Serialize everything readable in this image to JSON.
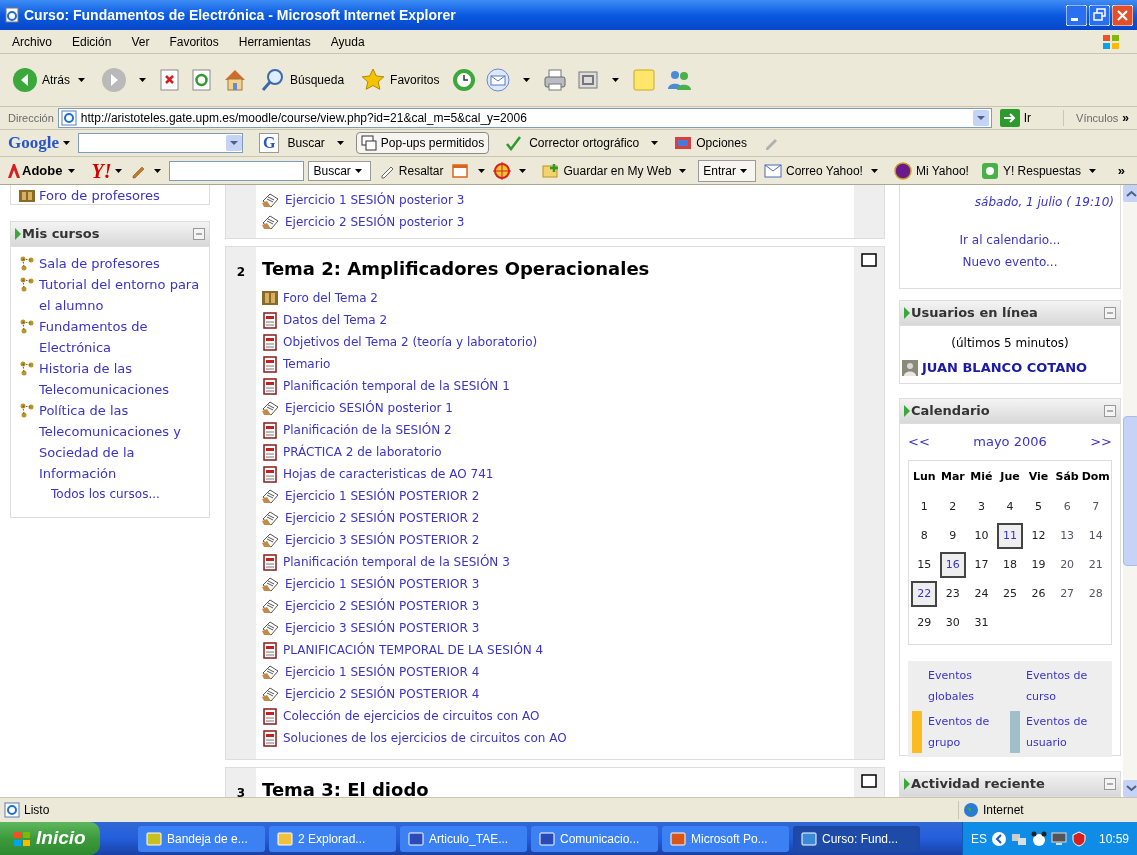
{
  "window": {
    "title": "Curso: Fundamentos de Electrónica - Microsoft Internet Explorer"
  },
  "menu": [
    "Archivo",
    "Edición",
    "Ver",
    "Favoritos",
    "Herramientas",
    "Ayuda"
  ],
  "toolbar": {
    "back": "Atrás",
    "search": "Búsqueda",
    "favorites": "Favoritos"
  },
  "address": {
    "label": "Dirección",
    "url": "http://aristoteles.gate.upm.es/moodle/course/view.php?id=21&cal_m=5&cal_y=2006",
    "go": "Ir",
    "links": "Vínculos",
    "more": "»"
  },
  "google_bar": {
    "logo": "Google",
    "search_letter": "G",
    "search": "Buscar",
    "popups": "Pop-ups permitidos",
    "spell": "Corrector ortográfico",
    "options": "Opciones"
  },
  "yahoo_bar": {
    "adobe": "Adobe",
    "yahoo": "Y!",
    "search": "Buscar",
    "highlight": "Resaltar",
    "save": "Guardar en My Web",
    "enter": "Entrar",
    "mail": "Correo Yahoo!",
    "my": "Mi Yahoo!",
    "answers": "Y! Respuestas",
    "more": "»"
  },
  "left": {
    "top_item": "Foro de profesores",
    "block": {
      "title": "Mis cursos",
      "items": [
        "Sala de profesores",
        "Tutorial del entorno para el alumno",
        "Fundamentos de Electrónica",
        "Historia de las Telecomunicaciones",
        "Política de las Telecomunicaciones y Sociedad de la Información"
      ],
      "all": "Todos los cursos..."
    }
  },
  "center": {
    "sections": [
      {
        "items": [
          {
            "label": "Ejercicio 1 SESIÓN posterior 3",
            "kind": "quiz"
          },
          {
            "label": "Ejercicio 2 SESIÓN posterior 3",
            "kind": "quiz"
          }
        ]
      },
      {
        "number": "2",
        "title": "Tema 2: Amplificadores Operacionales",
        "items": [
          {
            "label": "Foro del Tema 2",
            "kind": "forum"
          },
          {
            "label": "Datos del Tema 2",
            "kind": "pdf"
          },
          {
            "label": "Objetivos del Tema 2 (teoría y laboratorio)",
            "kind": "pdf"
          },
          {
            "label": "Temario",
            "kind": "pdf"
          },
          {
            "label": "Planificación temporal de la SESIÓN 1",
            "kind": "pdf"
          },
          {
            "label": "Ejercicio SESIÓN posterior 1",
            "kind": "quiz"
          },
          {
            "label": "Planificación de la SESIÓN 2",
            "kind": "pdf"
          },
          {
            "label": "PRÁCTICA 2 de laboratorio",
            "kind": "pdf"
          },
          {
            "label": "Hojas de caracteristicas de AO 741",
            "kind": "pdf"
          },
          {
            "label": "Ejercicio 1 SESIÓN POSTERIOR 2",
            "kind": "quiz"
          },
          {
            "label": "Ejercicio 2 SESIÓN POSTERIOR 2",
            "kind": "quiz"
          },
          {
            "label": "Ejercicio 3 SESIÓN POSTERIOR 2",
            "kind": "quiz"
          },
          {
            "label": "Planificación temporal de la SESIÓN 3",
            "kind": "pdf"
          },
          {
            "label": "Ejercicio 1 SESIÓN POSTERIOR 3",
            "kind": "quiz"
          },
          {
            "label": "Ejercicio 2 SESIÓN POSTERIOR 3",
            "kind": "quiz"
          },
          {
            "label": "Ejercicio 3 SESIÓN POSTERIOR 3",
            "kind": "quiz"
          },
          {
            "label": "PLANIFICACIÓN TEMPORAL DE LA SESIÓN 4",
            "kind": "pdf"
          },
          {
            "label": "Ejercicio 1 SESIÓN POSTERIOR 4",
            "kind": "quiz"
          },
          {
            "label": "Ejercicio 2 SESIÓN POSTERIOR 4",
            "kind": "quiz"
          },
          {
            "label": "Colección de ejercicios de circuitos con AO",
            "kind": "pdf"
          },
          {
            "label": "Soluciones de los ejercicios de circuitos con AO",
            "kind": "pdf"
          }
        ]
      },
      {
        "number": "3",
        "title": "Tema 3: El diodo"
      }
    ]
  },
  "right": {
    "events": {
      "date": "sábado, 1 julio ( 19:10)",
      "links": [
        "Ir al calendario...",
        "Nuevo evento..."
      ]
    },
    "online": {
      "title": "Usuarios en línea",
      "note": "(últimos 5 minutos)",
      "users": [
        "JUAN BLANCO COTANO"
      ]
    },
    "calendar": {
      "title": "Calendario",
      "prev": "<<",
      "month": "mayo 2006",
      "next": ">>",
      "weekdays": [
        "Lun",
        "Mar",
        "Mié",
        "Jue",
        "Vie",
        "Sáb",
        "Dom"
      ],
      "days": [
        {
          "label": "1",
          "highlighted": false
        },
        {
          "label": "2",
          "highlighted": false
        },
        {
          "label": "3",
          "highlighted": false
        },
        {
          "label": "4",
          "highlighted": false
        },
        {
          "label": "5",
          "highlighted": false
        },
        {
          "label": "6",
          "highlighted": false
        },
        {
          "label": "7",
          "highlighted": false
        },
        {
          "label": "8",
          "highlighted": false
        },
        {
          "label": "9",
          "highlighted": false
        },
        {
          "label": "10",
          "highlighted": false
        },
        {
          "label": "11",
          "highlighted": true
        },
        {
          "label": "12",
          "highlighted": false
        },
        {
          "label": "13",
          "highlighted": false
        },
        {
          "label": "14",
          "highlighted": false
        },
        {
          "label": "15",
          "highlighted": false
        },
        {
          "label": "16",
          "highlighted": true
        },
        {
          "label": "17",
          "highlighted": false
        },
        {
          "label": "18",
          "highlighted": false
        },
        {
          "label": "19",
          "highlighted": false
        },
        {
          "label": "20",
          "highlighted": false
        },
        {
          "label": "21",
          "highlighted": false
        },
        {
          "label": "22",
          "highlighted": true
        },
        {
          "label": "23",
          "highlighted": false
        },
        {
          "label": "24",
          "highlighted": false
        },
        {
          "label": "25",
          "highlighted": false
        },
        {
          "label": "26",
          "highlighted": false
        },
        {
          "label": "27",
          "highlighted": false
        },
        {
          "label": "28",
          "highlighted": false
        },
        {
          "label": "29",
          "highlighted": false
        },
        {
          "label": "30",
          "highlighted": false
        },
        {
          "label": "31",
          "highlighted": false
        }
      ],
      "legend": [
        {
          "label": "Eventos globales"
        },
        {
          "label": "Eventos de curso"
        },
        {
          "label": "Eventos de grupo",
          "color": "#fbbc21"
        },
        {
          "label": "Eventos de usuario",
          "color": "#a1bfcb"
        }
      ]
    },
    "recent": {
      "title": "Actividad reciente"
    }
  },
  "status": {
    "text": "Listo",
    "zone": "Internet"
  },
  "taskbar": {
    "start": "Inicio",
    "tasks": [
      {
        "label": "Bandeja de e...",
        "kind": "mail",
        "selected": false
      },
      {
        "label": "2 Explorad...",
        "kind": "folder",
        "selected": false
      },
      {
        "label": "Articulo_TAE...",
        "kind": "word",
        "selected": false
      },
      {
        "label": "Comunicacio...",
        "kind": "word",
        "selected": false
      },
      {
        "label": "Microsoft Po...",
        "kind": "ppt",
        "selected": false
      },
      {
        "label": "Curso: Fund...",
        "kind": "ie",
        "selected": true
      }
    ],
    "lang": "ES",
    "clock": "10:59"
  }
}
